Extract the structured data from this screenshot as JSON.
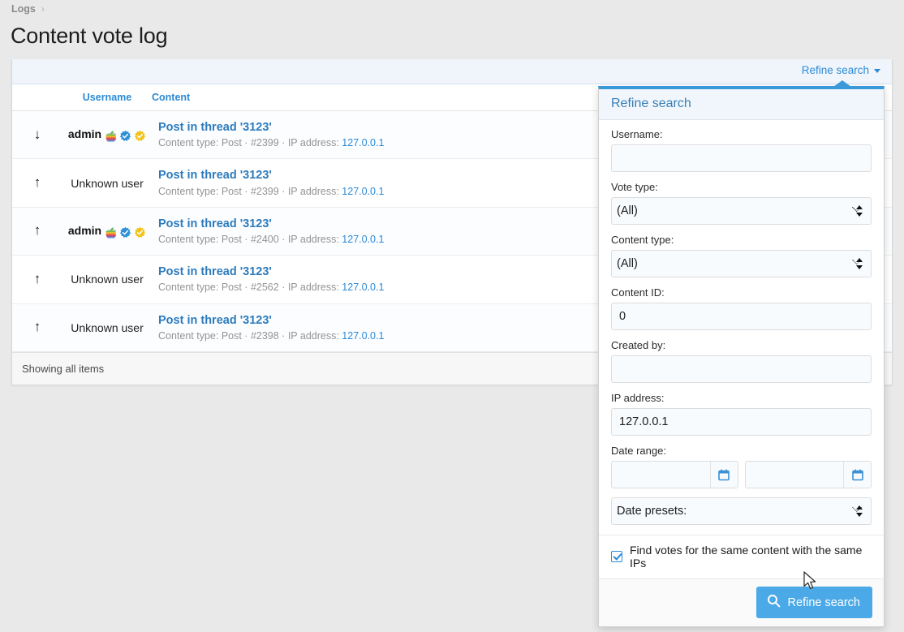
{
  "breadcrumb": {
    "root": "Logs",
    "separator": "›"
  },
  "page_title": "Content vote log",
  "toolbar": {
    "refine_link": "Refine search"
  },
  "table": {
    "columns": {
      "vote": "",
      "username": "Username",
      "content": "Content"
    },
    "rows": [
      {
        "vote_icon": "arrow-down-icon",
        "vote_arrow": "↓",
        "username": "admin",
        "is_member": true,
        "badges": [
          "apple-rainbow-icon",
          "verified-blue-icon",
          "verified-gold-icon"
        ],
        "content_title": "Post in thread '3123'",
        "meta_prefix": "Content type: Post · #2399 · IP address: ",
        "content_type": "Post",
        "content_id": "#2399",
        "ip": "127.0.0.1"
      },
      {
        "vote_icon": "arrow-up-icon",
        "vote_arrow": "↑",
        "username": "Unknown user",
        "is_member": false,
        "badges": [],
        "content_title": "Post in thread '3123'",
        "meta_prefix": "Content type: Post · #2399 · IP address: ",
        "content_type": "Post",
        "content_id": "#2399",
        "ip": "127.0.0.1"
      },
      {
        "vote_icon": "arrow-up-icon",
        "vote_arrow": "↑",
        "username": "admin",
        "is_member": true,
        "badges": [
          "apple-rainbow-icon",
          "verified-blue-icon",
          "verified-gold-icon"
        ],
        "content_title": "Post in thread '3123'",
        "meta_prefix": "Content type: Post · #2400 · IP address: ",
        "content_type": "Post",
        "content_id": "#2400",
        "ip": "127.0.0.1"
      },
      {
        "vote_icon": "arrow-up-icon",
        "vote_arrow": "↑",
        "username": "Unknown user",
        "is_member": false,
        "badges": [],
        "content_title": "Post in thread '3123'",
        "meta_prefix": "Content type: Post · #2562 · IP address: ",
        "content_type": "Post",
        "content_id": "#2562",
        "ip": "127.0.0.1"
      },
      {
        "vote_icon": "arrow-up-icon",
        "vote_arrow": "↑",
        "username": "Unknown user",
        "is_member": false,
        "badges": [],
        "content_title": "Post in thread '3123'",
        "meta_prefix": "Content type: Post · #2398 · IP address: ",
        "content_type": "Post",
        "content_id": "#2398",
        "ip": "127.0.0.1"
      }
    ],
    "footer": "Showing all items"
  },
  "refine_panel": {
    "heading": "Refine search",
    "fields": {
      "username": {
        "label": "Username:",
        "value": "",
        "placeholder": ""
      },
      "vote_type": {
        "label": "Vote type:",
        "value": "(All)",
        "options": [
          "(All)"
        ]
      },
      "content_type": {
        "label": "Content type:",
        "value": "(All)",
        "options": [
          "(All)"
        ]
      },
      "content_id": {
        "label": "Content ID:",
        "value": "0",
        "placeholder": ""
      },
      "created_by": {
        "label": "Created by:",
        "value": "",
        "placeholder": ""
      },
      "ip_address": {
        "label": "IP address:",
        "value": "127.0.0.1",
        "placeholder": ""
      },
      "date_range": {
        "label": "Date range:",
        "start_value": "",
        "end_value": "",
        "start_icon": "calendar-icon",
        "end_icon": "calendar-icon"
      },
      "date_presets": {
        "value": "Date presets:",
        "options": [
          "Date presets:"
        ]
      }
    },
    "checkbox": {
      "label": "Find votes for the same content with the same IPs",
      "checked": true
    },
    "submit_button": {
      "label": "Refine search",
      "icon": "search-icon"
    }
  },
  "colors": {
    "accent_blue": "#2c8ad6",
    "button_blue": "#4ba9e8",
    "panel_border_top": "#3a9ad9",
    "page_bg": "#e9e9e9",
    "toolbar_bg": "#eff5fb",
    "stripe_bg": "#fbfdff"
  }
}
